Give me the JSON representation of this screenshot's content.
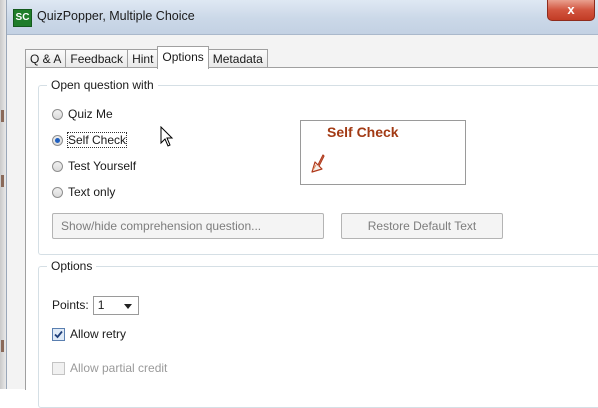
{
  "window": {
    "app_icon": "SC",
    "title": "QuizPopper, Multiple Choice",
    "close_label": "x"
  },
  "tabs": [
    {
      "label": "Q & A",
      "active": false
    },
    {
      "label": "Feedback",
      "active": false
    },
    {
      "label": "Hint",
      "active": false
    },
    {
      "label": "Options",
      "active": true
    },
    {
      "label": "Metadata",
      "active": false
    }
  ],
  "open_question": {
    "legend": "Open question with",
    "options": [
      {
        "label": "Quiz Me",
        "checked": false
      },
      {
        "label": "Self Check",
        "checked": true
      },
      {
        "label": "Test Yourself",
        "checked": false
      },
      {
        "label": "Text only",
        "checked": false
      }
    ],
    "comprehension_button": "Show/hide comprehension question...",
    "restore_button": "Restore Default Text",
    "preview_title": "Self Check",
    "preview_icon": "pencil-arrow-icon"
  },
  "options": {
    "legend": "Options",
    "points_label": "Points:",
    "points_value": "1",
    "allow_retry_label": "Allow retry",
    "allow_retry_checked": true,
    "allow_partial_label": "Allow partial credit",
    "allow_partial_checked": false,
    "allow_partial_enabled": false
  },
  "colors": {
    "preview_title": "#a23a14",
    "titlebar": "#cbd8e8",
    "close_button": "#c23c25",
    "app_icon": "#1f7d2a"
  }
}
